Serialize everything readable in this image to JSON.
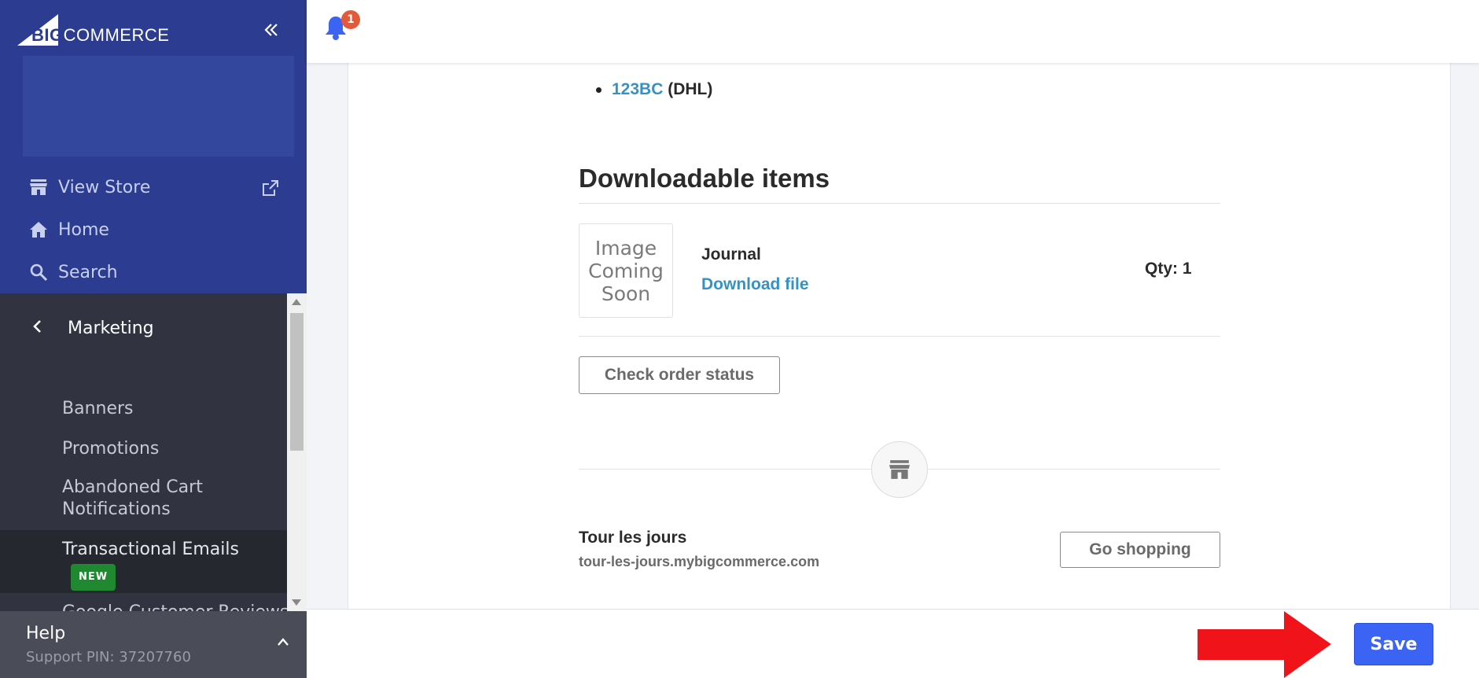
{
  "sidebar": {
    "logo": {
      "prefix": "BIG",
      "suffix": "COMMERCE"
    },
    "collapse_icon": "double-chevron-left-icon",
    "nav": {
      "view_store": "View Store",
      "home": "Home",
      "search": "Search"
    },
    "menu": {
      "back_label": "Marketing",
      "items": [
        {
          "label": "Banners"
        },
        {
          "label": "Promotions"
        },
        {
          "label": "Abandoned Cart Notifications"
        },
        {
          "label": "Transactional Emails",
          "badge": "NEW",
          "active": true
        },
        {
          "label": "Google Customer Reviews"
        }
      ]
    },
    "help": {
      "title": "Help",
      "pin": "Support PIN: 37207760"
    }
  },
  "topbar": {
    "notification_count": "1"
  },
  "email": {
    "tracking": {
      "number": "123BC",
      "carrier": "(DHL)"
    },
    "downloadable_heading": "Downloadable items",
    "item": {
      "thumb_text": "Image Coming Soon",
      "name": "Journal",
      "download_link": "Download file",
      "qty": "Qty: 1"
    },
    "check_status_button": "Check order status",
    "store": {
      "name": "Tour les jours",
      "url": "tour-les-jours.mybigcommerce.com",
      "go_shopping_button": "Go shopping"
    }
  },
  "footer": {
    "save_label": "Save"
  },
  "colors": {
    "sidebar_top": "#2b3c91",
    "sidebar_dark": "#313440",
    "link_blue": "#3592c4",
    "save_blue": "#3c64f4",
    "arrow_red": "#f0141a",
    "badge_green": "#208831",
    "notification_orange": "#e35a3a"
  }
}
